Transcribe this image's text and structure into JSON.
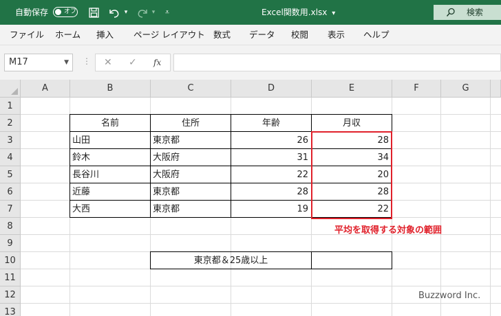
{
  "titlebar": {
    "autosave_label": "自動保存",
    "autosave_toggle": "オフ",
    "filename": "Excel関数用.xlsx",
    "filename_dropdown": "▾",
    "search_label": "検索",
    "icons": [
      "save-icon",
      "undo-icon",
      "redo-icon",
      "customize-qat-icon",
      "search-icon"
    ]
  },
  "menu": [
    "ファイル",
    "ホーム",
    "挿入",
    "ページ レイアウト",
    "数式",
    "データ",
    "校閲",
    "表示",
    "ヘルプ"
  ],
  "formula_bar": {
    "name_box": "M17",
    "separator": "⋮",
    "cancel": "✕",
    "enter": "✓",
    "fx": "fx",
    "formula": ""
  },
  "sheet": {
    "columns": [
      "A",
      "B",
      "C",
      "D",
      "E",
      "F",
      "G"
    ],
    "rows": [
      "1",
      "2",
      "3",
      "4",
      "5",
      "6",
      "7",
      "8",
      "9",
      "10",
      "11",
      "12",
      "13"
    ],
    "table_headers": [
      "名前",
      "住所",
      "年齢",
      "月収"
    ],
    "table_rows": [
      [
        "山田",
        "東京都",
        "26",
        "28"
      ],
      [
        "鈴木",
        "大阪府",
        "31",
        "34"
      ],
      [
        "長谷川",
        "大阪府",
        "22",
        "20"
      ],
      [
        "近藤",
        "東京都",
        "28",
        "28"
      ],
      [
        "大西",
        "東京都",
        "19",
        "22"
      ]
    ],
    "condition_label": "東京都＆25歳以上",
    "condition_result": "",
    "annotation": "平均を取得する対象の範囲",
    "highlight_color": "#e0202a"
  },
  "watermark": "Buzzword Inc.",
  "colors": {
    "titlebar": "#217346",
    "ribbon": "#f3f3f3",
    "header": "#e6e6e6"
  }
}
